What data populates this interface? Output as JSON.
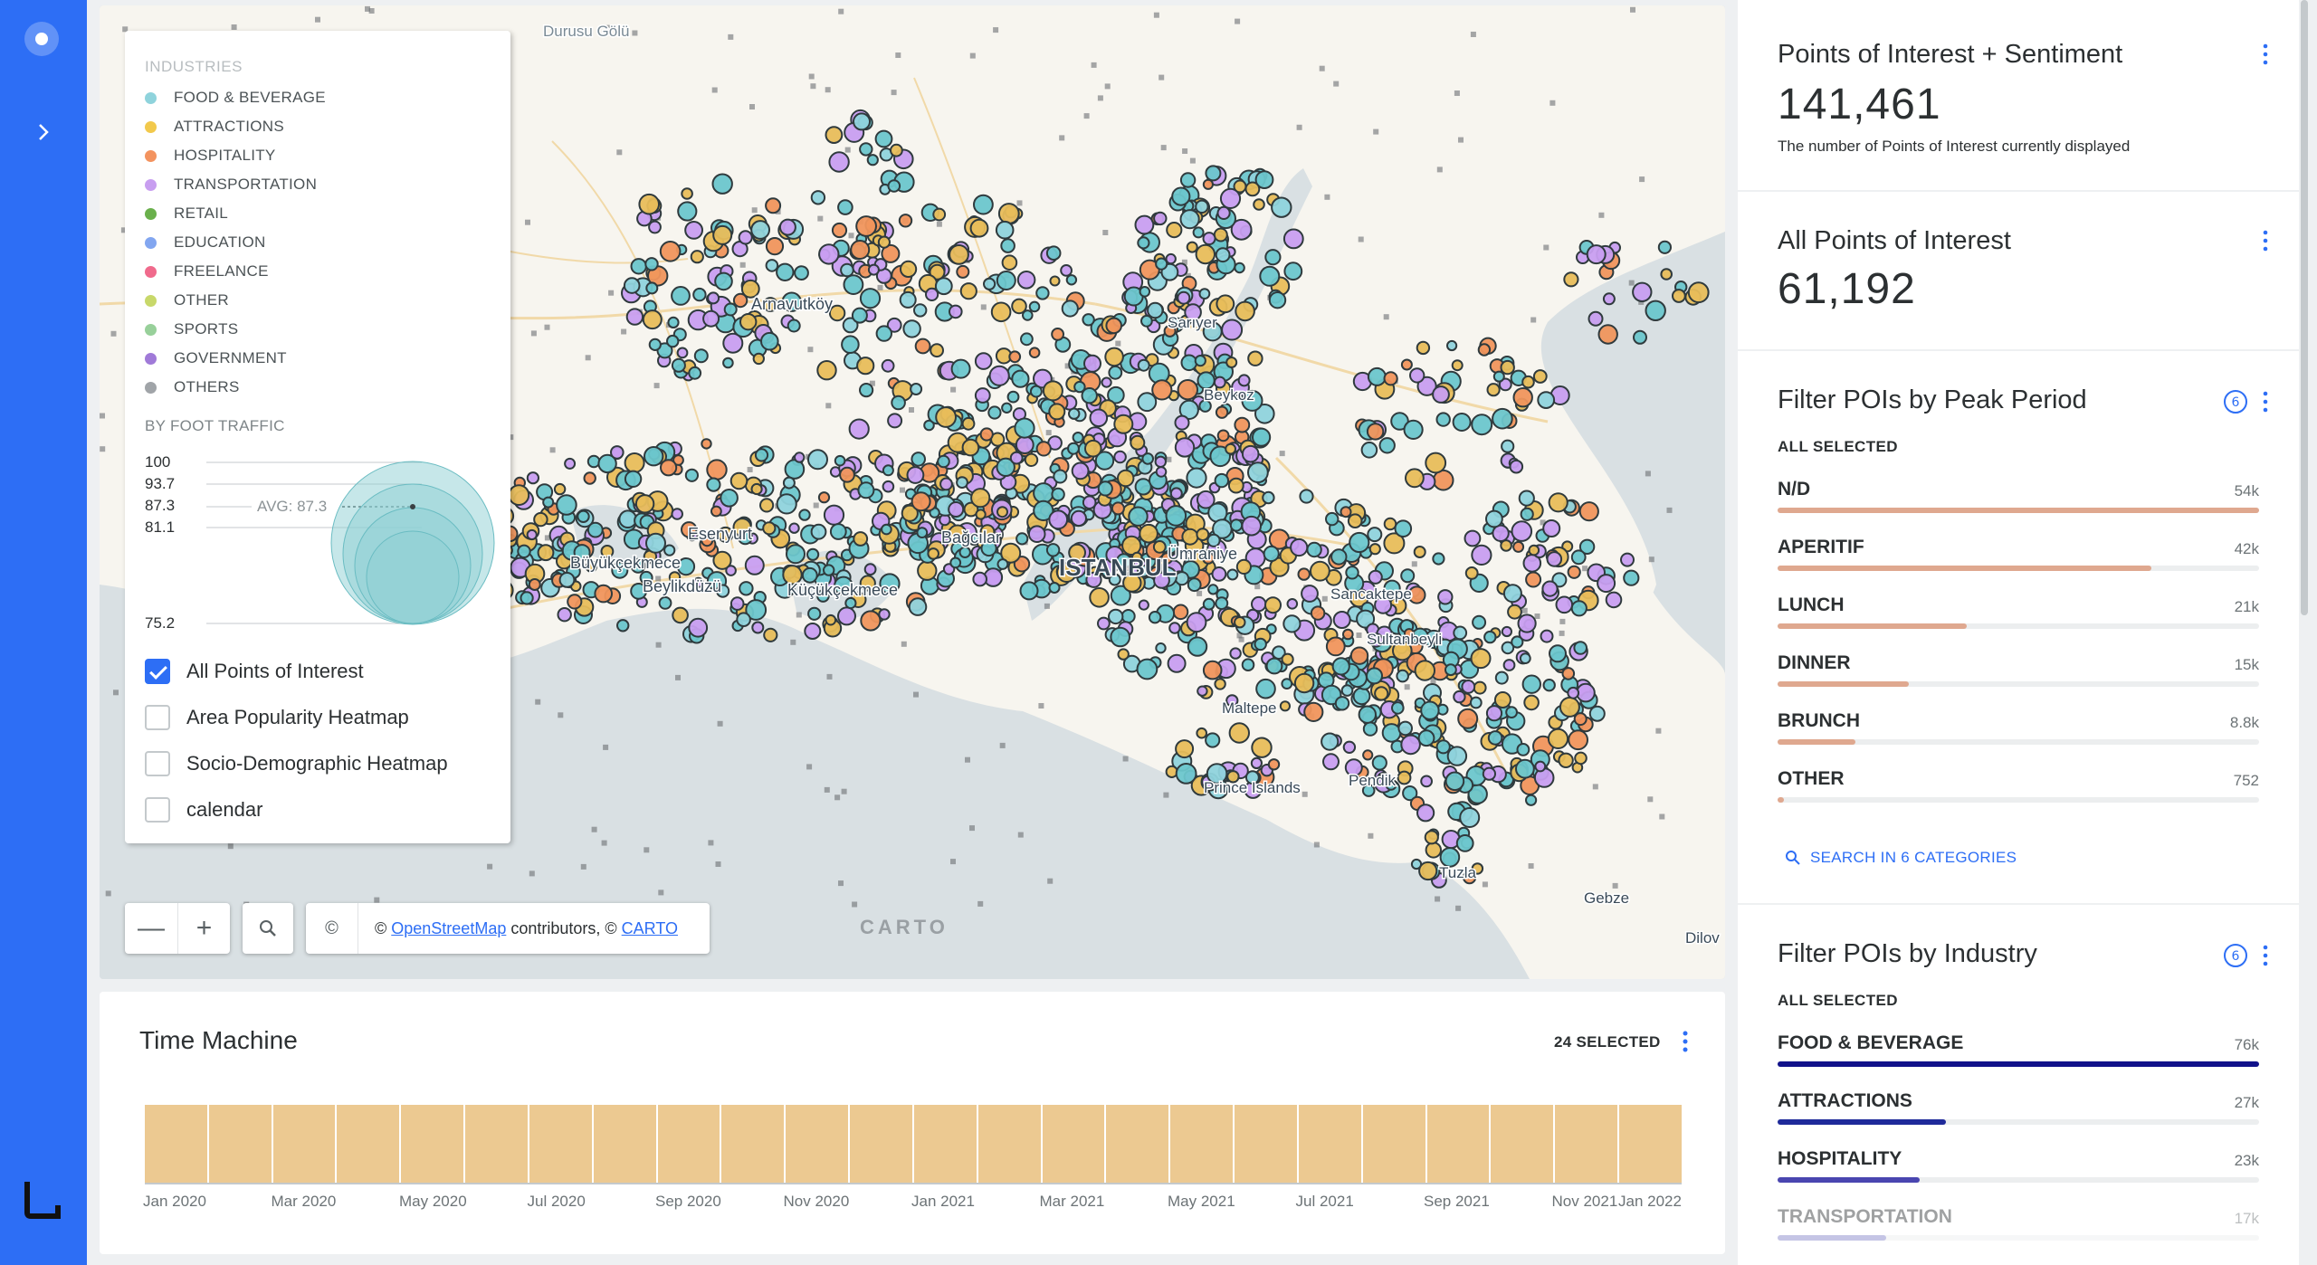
{
  "map": {
    "places": [
      {
        "name": "Durusu Gölü"
      },
      {
        "name": "Arnavutköy"
      },
      {
        "name": "Sarıyer"
      },
      {
        "name": "Beykoz"
      },
      {
        "name": "Esenyurt"
      },
      {
        "name": "Bağcılar"
      },
      {
        "name": "ISTANBUL"
      },
      {
        "name": "Ümraniye"
      },
      {
        "name": "Büyükçekmece"
      },
      {
        "name": "Beylikdüzü"
      },
      {
        "name": "Küçükçekmece"
      },
      {
        "name": "Sancaktepe"
      },
      {
        "name": "Sultanbeyli"
      },
      {
        "name": "Maltepe"
      },
      {
        "name": "Pendik"
      },
      {
        "name": "Prince Islands"
      },
      {
        "name": "Tuzla"
      },
      {
        "name": "Gebze"
      },
      {
        "name": "Dilov"
      }
    ],
    "legend": {
      "title": "INDUSTRIES",
      "items": [
        {
          "label": "FOOD & BEVERAGE",
          "color": "#8fd3dc"
        },
        {
          "label": "ATTRACTIONS",
          "color": "#f2c94c"
        },
        {
          "label": "HOSPITALITY",
          "color": "#f3935f"
        },
        {
          "label": "TRANSPORTATION",
          "color": "#c89ef0"
        },
        {
          "label": "RETAIL",
          "color": "#6ab04c"
        },
        {
          "label": "EDUCATION",
          "color": "#82a6f0"
        },
        {
          "label": "FREELANCE",
          "color": "#f06a8c"
        },
        {
          "label": "OTHER",
          "color": "#c8d86a"
        },
        {
          "label": "SPORTS",
          "color": "#98d09a"
        },
        {
          "label": "GOVERNMENT",
          "color": "#a07ad8"
        },
        {
          "label": "OTHERS",
          "color": "#a0a4a8"
        }
      ],
      "foot_traffic_title": "BY FOOT TRAFFIC",
      "foot_traffic_levels": [
        "100",
        "93.7",
        "87.3",
        "81.1",
        "75.2"
      ],
      "avg_label": "AVG: 87.3",
      "layers": [
        {
          "label": "All Points of Interest",
          "checked": true
        },
        {
          "label": "Area Popularity Heatmap",
          "checked": false
        },
        {
          "label": "Socio-Demographic Heatmap",
          "checked": false
        },
        {
          "label": "calendar",
          "checked": false
        }
      ]
    },
    "controls": {
      "zoom_out": "—",
      "zoom_in": "+",
      "attribution_icon": "©"
    },
    "attribution": {
      "prefix": "© ",
      "osm": "OpenStreetMap",
      "middle": " contributors, © ",
      "carto": "CARTO"
    },
    "logo": "CARTO"
  },
  "time_machine": {
    "title": "Time Machine",
    "selected": "24 SELECTED",
    "bar_count": 24,
    "labels": [
      "Jan 2020",
      "Mar 2020",
      "May 2020",
      "Jul 2020",
      "Sep 2020",
      "Nov 2020",
      "Jan 2021",
      "Mar 2021",
      "May 2021",
      "Jul 2021",
      "Sep 2021",
      "Nov 2021",
      "Jan 2022"
    ]
  },
  "panel": {
    "poi_sentiment": {
      "title": "Points of Interest + Sentiment",
      "value": "141,461",
      "note": "The number of Points of Interest currently displayed"
    },
    "all_poi": {
      "title": "All Points of Interest",
      "value": "61,192"
    },
    "peak_period": {
      "title": "Filter POIs by Peak Period",
      "selection": "ALL SELECTED",
      "color": "#dfa88f",
      "rows": [
        {
          "label": "N/D",
          "value": "54k",
          "fraction": 1.0
        },
        {
          "label": "APERITIF",
          "value": "42k",
          "fraction": 0.776
        },
        {
          "label": "LUNCH",
          "value": "21k",
          "fraction": 0.393
        },
        {
          "label": "DINNER",
          "value": "15k",
          "fraction": 0.272
        },
        {
          "label": "BRUNCH",
          "value": "8.8k",
          "fraction": 0.162
        },
        {
          "label": "OTHER",
          "value": "752",
          "fraction": 0.014
        }
      ],
      "search": "SEARCH IN 6 CATEGORIES"
    },
    "industry": {
      "title": "Filter POIs by Industry",
      "selection": "ALL SELECTED",
      "rows": [
        {
          "label": "FOOD & BEVERAGE",
          "value": "76k",
          "fraction": 1.0,
          "color": "#11128a"
        },
        {
          "label": "ATTRACTIONS",
          "value": "27k",
          "fraction": 0.35,
          "color": "#1f2a9a"
        },
        {
          "label": "HOSPITALITY",
          "value": "23k",
          "fraction": 0.295,
          "color": "#4a46b0"
        },
        {
          "label": "TRANSPORTATION",
          "value": "17k",
          "fraction": 0.225,
          "color": "#7f7fc6"
        }
      ]
    }
  }
}
